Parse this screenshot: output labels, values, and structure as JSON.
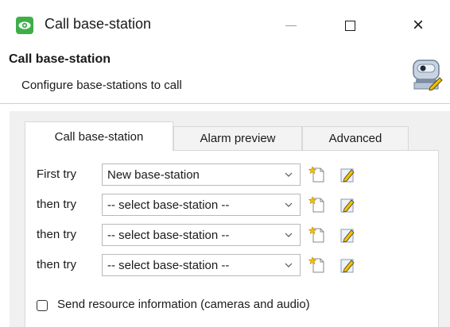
{
  "window": {
    "title": "Call base-station",
    "icon": "camera-eye-icon",
    "controls": {
      "minimize": "minimize-icon",
      "maximize": "maximize-icon",
      "close": "×"
    }
  },
  "header": {
    "title": "Call base-station",
    "subtitle": "Configure base-stations to call",
    "icon": "base-station-edit-icon"
  },
  "tabs": [
    {
      "label": "Call base-station",
      "active": true
    },
    {
      "label": "Alarm preview",
      "active": false
    },
    {
      "label": "Advanced",
      "active": false
    }
  ],
  "rows": [
    {
      "label": "First try",
      "value": "New base-station"
    },
    {
      "label": "then try",
      "value": "-- select base-station --"
    },
    {
      "label": "then try",
      "value": "-- select base-station --"
    },
    {
      "label": "then try",
      "value": "-- select base-station --"
    }
  ],
  "checkbox": {
    "label": "Send resource information (cameras and audio)",
    "checked": false
  },
  "colors": {
    "app_icon": "#3fae49",
    "panel_bg": "#f0f0f0",
    "new_icon": "#f2c200",
    "edit_icon": "#3d6fb5"
  }
}
